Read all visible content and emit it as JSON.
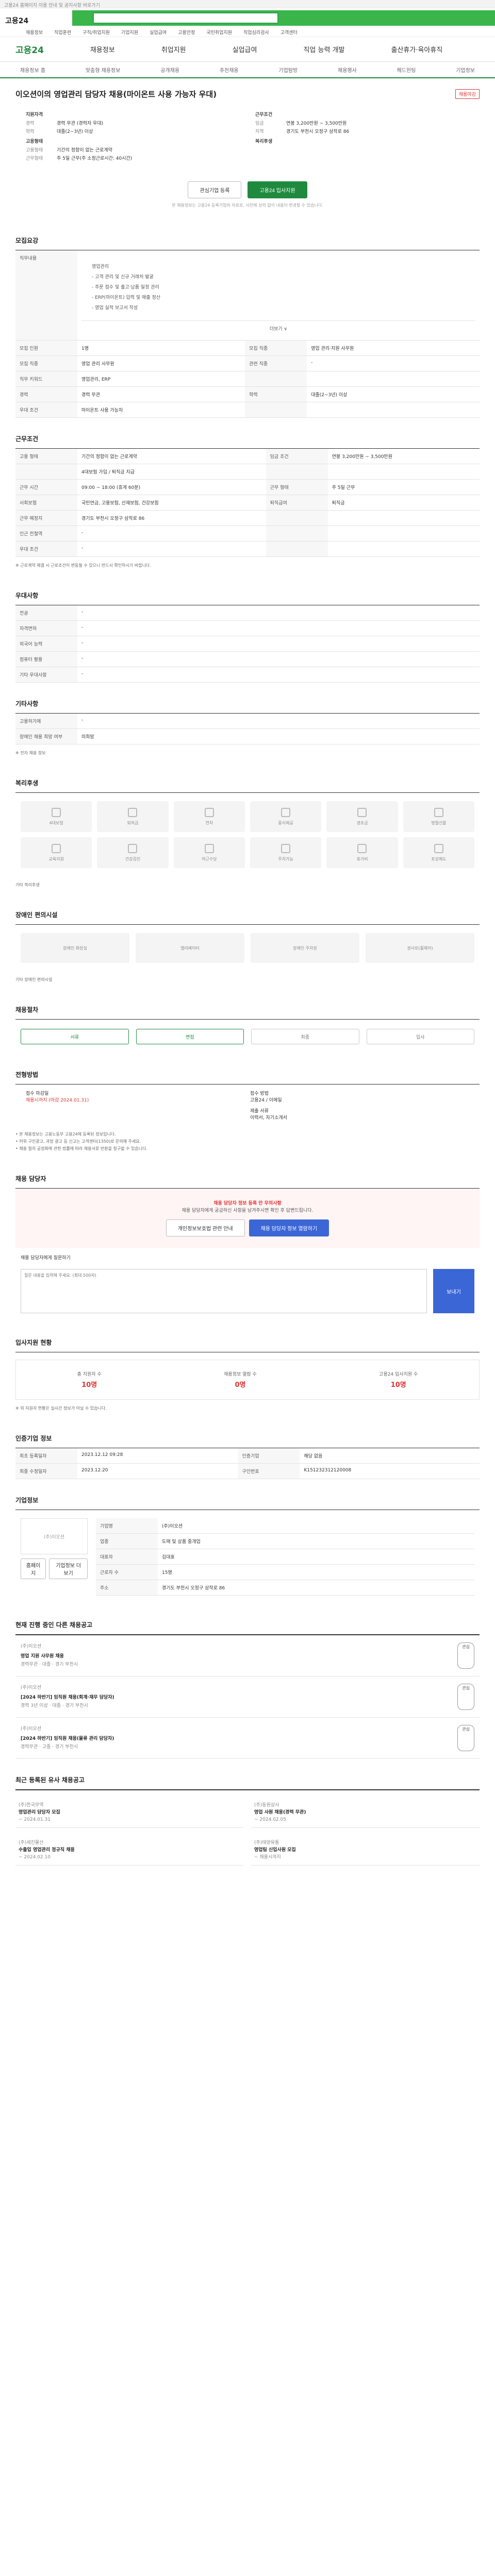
{
  "notice": "고용24 홈페이지 이용 안내 및 공지사항 바로가기",
  "logo": "고용24",
  "topmenu": [
    "채용정보",
    "직업훈련",
    "구직/취업지원",
    "기업지원",
    "실업급여",
    "고용안정",
    "국민취업지원",
    "직업심리검사",
    "고객센터"
  ],
  "gnb": {
    "brand": "고용24",
    "items": [
      "채용정보",
      "취업지원",
      "실업급여",
      "직업 능력 개발",
      "출산휴가·육아휴직"
    ]
  },
  "subnav": [
    "채용정보 홈",
    "맞춤형 채용정보",
    "공개채용",
    "추천채용",
    "기업탐방",
    "채용행사",
    "헤드헌팅",
    "기업정보"
  ],
  "head": {
    "title": "이오션이의 영업관리 담당자 채용(마이온트 사용 가능자 우대)",
    "badge": "채용마감",
    "summary_left_label": "지원자격",
    "summary_right_label": "근무조건",
    "left_rows": [
      {
        "k": "경력",
        "v": "경력 무관 (경력자 우대)"
      },
      {
        "k": "학력",
        "v": "대졸(2~3년) 이상"
      }
    ],
    "right_rows": [
      {
        "k": "임금",
        "v": "연봉 3,200만원 ~ 3,500만원"
      },
      {
        "k": "지역",
        "v": "경기도 부천시 오정구 삼작로 86"
      }
    ],
    "left_rows2_label": "고용형태",
    "left_rows2": [
      {
        "k": "고용형태",
        "v": "기간의 정함이 없는 근로계약"
      },
      {
        "k": "근무형태",
        "v": "주 5일 근무(주 소정근로시간: 40시간)"
      }
    ],
    "right_rows2_label": "복리후생",
    "btn_interest": "관심기업 등록",
    "btn_apply": "고용24 입사지원",
    "smallnote": "본 채용정보는 고용24 등록기업의 자료로, 사전에 상의 없이 내용이 변경될 수 있습니다."
  },
  "recruit": {
    "title": "모집요강",
    "duty_label": "직무내용",
    "duty_lines": [
      "영업관리",
      "- 고객 관리 및 신규 거래처 발굴",
      "- 주문 접수 및 출고·납품 일정 관리",
      "- ERP(마이온트) 입력 및 매출 정산",
      "- 영업 실적 보고서 작성"
    ],
    "more": "더보기 ∨",
    "rows": [
      {
        "k": "모집 인원",
        "v": "1명",
        "k2": "모집 직종",
        "v2": "영업 관리·지원 사무원"
      },
      {
        "k": "모집 직종",
        "v": "영업 관리 사무원",
        "k2": "관련 직종",
        "v2": "-"
      },
      {
        "k": "직무 키워드",
        "v": "영업관리, ERP",
        "k2": "",
        "v2": ""
      },
      {
        "k": "경력",
        "v": "경력 무관",
        "k2": "학력",
        "v2": "대졸(2~3년) 이상"
      },
      {
        "k": "우대 조건",
        "v": "마이온트 사용 가능자",
        "k2": "",
        "v2": ""
      }
    ]
  },
  "work": {
    "title": "근무조건",
    "rows": [
      {
        "k": "고용 형태",
        "v": "기간의 정함이 없는 근로계약",
        "k2": "임금 조건",
        "v2": "연봉 3,200만원 ~ 3,500만원"
      },
      {
        "k": "",
        "v": "4대보험 가입 / 퇴직금 지급",
        "k2": "",
        "v2": ""
      },
      {
        "k": "근무 시간",
        "v": "09:00 ~ 18:00 (휴게 60분)",
        "k2": "근무 형태",
        "v2": "주 5일 근무"
      },
      {
        "k": "사회보험",
        "v": "국민연금, 고용보험, 산재보험, 건강보험",
        "k2": "퇴직급여",
        "v2": "퇴직금"
      },
      {
        "k": "근무 예정지",
        "v": "경기도 부천시 오정구 삼작로 86",
        "k2": "",
        "v2": ""
      },
      {
        "k": "인근 전철역",
        "v": "-",
        "k2": "",
        "v2": ""
      },
      {
        "k": "우대 조건",
        "v": "-",
        "k2": "",
        "v2": ""
      }
    ],
    "note": "※ 근로계약 체결 시 근로조건이 변동될 수 있으니 반드시 확인하시기 바랍니다."
  },
  "etc": {
    "title": "우대사항",
    "rows": [
      {
        "k": "전공",
        "v": "-"
      },
      {
        "k": "자격면허",
        "v": "-"
      },
      {
        "k": "외국어 능력",
        "v": "-"
      },
      {
        "k": "컴퓨터 활용",
        "v": "-"
      },
      {
        "k": "기타 우대사항",
        "v": "-"
      }
    ]
  },
  "other": {
    "title": "기타사항",
    "rows": [
      {
        "k": "고용허가제",
        "v": "-"
      },
      {
        "k": "장애인 채용 희망 여부",
        "v": "미희망"
      }
    ],
    "note": "※ 전자 채용 정보"
  },
  "welfare": {
    "title": "복리후생",
    "items": [
      "4대보험",
      "퇴직금",
      "연차",
      "중식제공",
      "경조금",
      "명절선물",
      "교육지원",
      "건강검진",
      "야근수당",
      "주차가능",
      "휴가비",
      "포상제도"
    ],
    "footnote": "기타 복리후생"
  },
  "disability": {
    "title": "장애인 편의시설",
    "items": [
      "장애인 화장실",
      "엘리베이터",
      "장애인 주차장",
      "경사로(휠체어)"
    ],
    "footnote": "기타 장애인 편의시설"
  },
  "process": {
    "title": "채용절차",
    "steps": [
      "서류",
      "면접",
      "최종",
      "입사"
    ]
  },
  "apply": {
    "title": "전형방법",
    "deadline_label": "접수 마감일",
    "deadline": "채용시까지 (마감 2024.01.31)",
    "method_label": "접수 방법",
    "method": "고용24 / 이메일",
    "docs_label": "제출 서류",
    "docs": "이력서, 자기소개서",
    "notes": [
      "• 본 채용정보는 고용노동부 고용24에 등록된 정보입니다.",
      "• 허위 구인광고, 과장 광고 등 신고는 고객센터(1350)로 문의해 주세요.",
      "• 채용 절차 공정화에 관한 법률에 따라 채용서류 반환을 청구할 수 있습니다."
    ]
  },
  "qna": {
    "title": "채용 담당자",
    "headline": "채용 담당자 정보 등록 안 무의사항",
    "sub": "채용 담당자에게 궁금하신 사항을 남겨주시면 확인 후 답변드립니다.",
    "btn1": "개인정보보호법 관련 안내",
    "btn2": "채용 담당자 정보 열람하기",
    "form_label": "채용 담당자에게 질문하기",
    "placeholder": "질문 내용을 입력해 주세요. (최대 500자)",
    "send": "보내기"
  },
  "stats": {
    "title": "입사지원 현황",
    "items": [
      {
        "label": "총 지원자 수",
        "value": "10명"
      },
      {
        "label": "채용정보 열람 수",
        "value": "0명"
      },
      {
        "label": "고용24 입사지원 수",
        "value": "10명"
      }
    ],
    "note": "※ 위 지원자 현황은 실시간 정보가 아닐 수 있습니다."
  },
  "jobinfo": {
    "title": "인증기업 정보",
    "rows": [
      {
        "k": "최초 등록일자",
        "v": "2023.12.12 09:28",
        "k2": "인증기업",
        "v2": "해당 없음"
      },
      {
        "k": "최종 수정일자",
        "v": "2023.12.20",
        "k2": "구인번호",
        "v2": "K151232312120008"
      }
    ]
  },
  "company": {
    "title": "기업정보",
    "logo": "(주)이오션",
    "rows": [
      {
        "k": "기업명",
        "v": "(주)이오션"
      },
      {
        "k": "업종",
        "v": "도매 및 상품 중개업"
      },
      {
        "k": "대표자",
        "v": "김대표"
      },
      {
        "k": "근로자 수",
        "v": "15명"
      },
      {
        "k": "주소",
        "v": "경기도 부천시 오정구 삼작로 86"
      }
    ],
    "buttons": [
      "홈페이지",
      "기업정보 더보기"
    ]
  },
  "similar": {
    "title": "현재 진행 중인 다른 채용공고",
    "jobs": [
      {
        "co": "(주)이오션",
        "t": "영업 지원 사무원 채용",
        "meta": "경력무관 · 대졸 · 경기 부천시",
        "btn": "관심"
      },
      {
        "co": "(주)이오션",
        "t": "[2024 하반기] 임직원 채용(회계·재무 담당자)",
        "meta": "경력 3년 이상 · 대졸 · 경기 부천시",
        "btn": "관심"
      },
      {
        "co": "(주)이오션",
        "t": "[2024 하반기] 임직원 채용(물류 관리 담당자)",
        "meta": "경력무관 · 고졸 · 경기 부천시",
        "btn": "관심"
      }
    ]
  },
  "related": {
    "title": "최근 등록된 유사 채용공고",
    "items": [
      {
        "co": "(주)한국무역",
        "tt": "영업관리 담당자 모집",
        "d": "~ 2024.01.31"
      },
      {
        "co": "(주)동원상사",
        "tt": "영업 사원 채용(경력 무관)",
        "d": "~ 2024.02.05"
      },
      {
        "co": "(주)세진물산",
        "tt": "수출입 영업관리 정규직 채용",
        "d": "~ 2024.02.10"
      },
      {
        "co": "(주)태양유통",
        "tt": "영업팀 신입사원 모집",
        "d": "~ 채용시까지"
      }
    ]
  }
}
